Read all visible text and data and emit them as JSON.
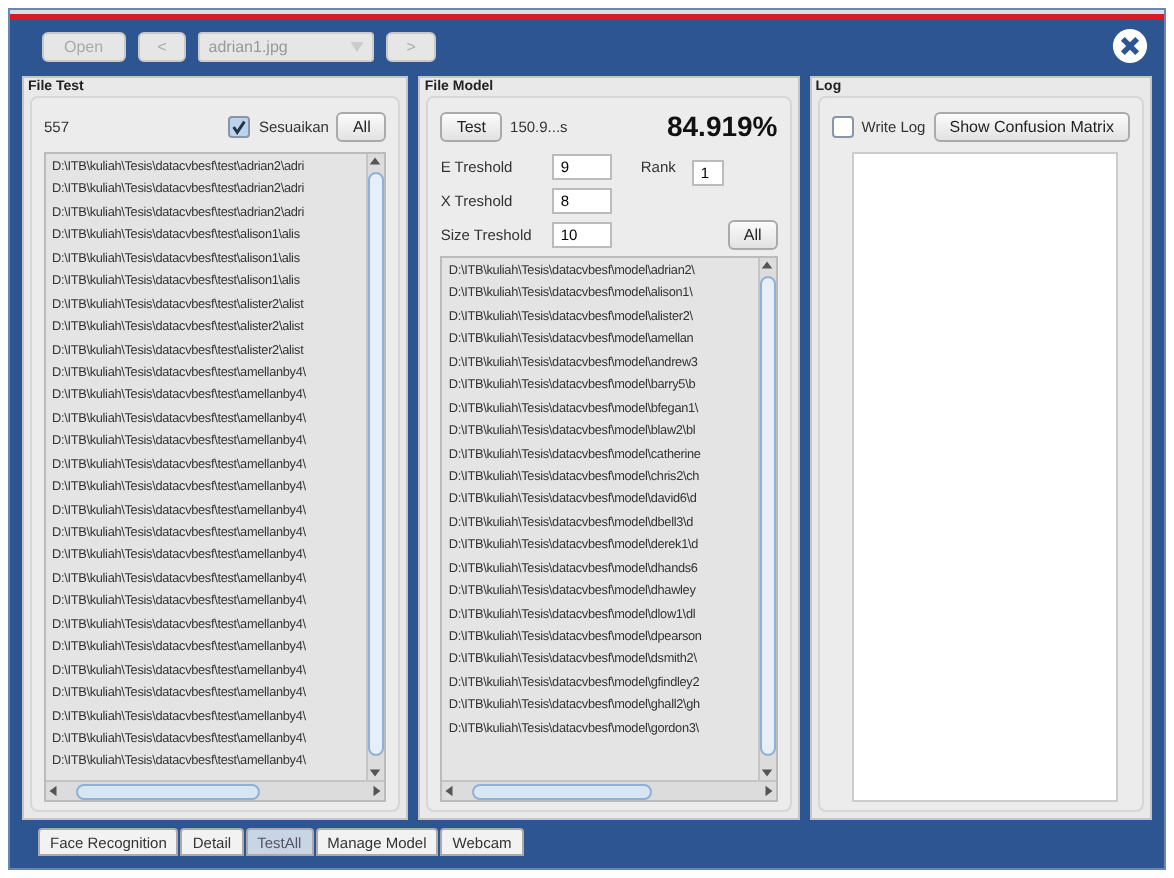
{
  "toolbar": {
    "open": {
      "label": "Open",
      "disabled": true
    },
    "prev": {
      "label": "<",
      "disabled": true
    },
    "file": {
      "value": "adrian1.jpg",
      "disabled": true
    },
    "next": {
      "label": ">",
      "disabled": true
    }
  },
  "file_test": {
    "title": "File Test",
    "count": "557",
    "adjust": {
      "label": "Sesuaikan",
      "checked": true
    },
    "all_button": "All",
    "files": [
      "D:\\ITB\\kuliah\\Tesis\\datacvbesf\\test\\adrian2\\adri",
      "D:\\ITB\\kuliah\\Tesis\\datacvbesf\\test\\adrian2\\adri",
      "D:\\ITB\\kuliah\\Tesis\\datacvbesf\\test\\adrian2\\adri",
      "D:\\ITB\\kuliah\\Tesis\\datacvbesf\\test\\alison1\\alis",
      "D:\\ITB\\kuliah\\Tesis\\datacvbesf\\test\\alison1\\alis",
      "D:\\ITB\\kuliah\\Tesis\\datacvbesf\\test\\alison1\\alis",
      "D:\\ITB\\kuliah\\Tesis\\datacvbesf\\test\\alister2\\alist",
      "D:\\ITB\\kuliah\\Tesis\\datacvbesf\\test\\alister2\\alist",
      "D:\\ITB\\kuliah\\Tesis\\datacvbesf\\test\\alister2\\alist",
      "D:\\ITB\\kuliah\\Tesis\\datacvbesf\\test\\amellanby4\\",
      "D:\\ITB\\kuliah\\Tesis\\datacvbesf\\test\\amellanby4\\",
      "D:\\ITB\\kuliah\\Tesis\\datacvbesf\\test\\amellanby4\\",
      "D:\\ITB\\kuliah\\Tesis\\datacvbesf\\test\\amellanby4\\",
      "D:\\ITB\\kuliah\\Tesis\\datacvbesf\\test\\amellanby4\\",
      "D:\\ITB\\kuliah\\Tesis\\datacvbesf\\test\\amellanby4\\",
      "D:\\ITB\\kuliah\\Tesis\\datacvbesf\\test\\amellanby4\\",
      "D:\\ITB\\kuliah\\Tesis\\datacvbesf\\test\\amellanby4\\",
      "D:\\ITB\\kuliah\\Tesis\\datacvbesf\\test\\amellanby4\\",
      "D:\\ITB\\kuliah\\Tesis\\datacvbesf\\test\\amellanby4\\",
      "D:\\ITB\\kuliah\\Tesis\\datacvbesf\\test\\amellanby4\\",
      "D:\\ITB\\kuliah\\Tesis\\datacvbesf\\test\\amellanby4\\",
      "D:\\ITB\\kuliah\\Tesis\\datacvbesf\\test\\amellanby4\\",
      "D:\\ITB\\kuliah\\Tesis\\datacvbesf\\test\\amellanby4\\",
      "D:\\ITB\\kuliah\\Tesis\\datacvbesf\\test\\amellanby4\\",
      "D:\\ITB\\kuliah\\Tesis\\datacvbesf\\test\\amellanby4\\",
      "D:\\ITB\\kuliah\\Tesis\\datacvbesf\\test\\amellanby4\\",
      "D:\\ITB\\kuliah\\Tesis\\datacvbesf\\test\\amellanby4\\"
    ]
  },
  "file_model": {
    "title": "File Model",
    "test_button": "Test",
    "time": "150.9...s",
    "accuracy": "84.919%",
    "fields": [
      {
        "label": "E Treshold",
        "value": "9"
      },
      {
        "label": "X Treshold",
        "value": "8"
      },
      {
        "label": "Size Treshold",
        "value": "10"
      }
    ],
    "rank": {
      "label": "Rank",
      "value": "1"
    },
    "all_button": "All",
    "files": [
      "D:\\ITB\\kuliah\\Tesis\\datacvbesf\\model\\adrian2\\",
      "D:\\ITB\\kuliah\\Tesis\\datacvbesf\\model\\alison1\\",
      "D:\\ITB\\kuliah\\Tesis\\datacvbesf\\model\\alister2\\",
      "D:\\ITB\\kuliah\\Tesis\\datacvbesf\\model\\amellan",
      "D:\\ITB\\kuliah\\Tesis\\datacvbesf\\model\\andrew3",
      "D:\\ITB\\kuliah\\Tesis\\datacvbesf\\model\\barry5\\b",
      "D:\\ITB\\kuliah\\Tesis\\datacvbesf\\model\\bfegan1\\",
      "D:\\ITB\\kuliah\\Tesis\\datacvbesf\\model\\blaw2\\bl",
      "D:\\ITB\\kuliah\\Tesis\\datacvbesf\\model\\catherine",
      "D:\\ITB\\kuliah\\Tesis\\datacvbesf\\model\\chris2\\ch",
      "D:\\ITB\\kuliah\\Tesis\\datacvbesf\\model\\david6\\d",
      "D:\\ITB\\kuliah\\Tesis\\datacvbesf\\model\\dbell3\\d",
      "D:\\ITB\\kuliah\\Tesis\\datacvbesf\\model\\derek1\\d",
      "D:\\ITB\\kuliah\\Tesis\\datacvbesf\\model\\dhands6",
      "D:\\ITB\\kuliah\\Tesis\\datacvbesf\\model\\dhawley",
      "D:\\ITB\\kuliah\\Tesis\\datacvbesf\\model\\dlow1\\dl",
      "D:\\ITB\\kuliah\\Tesis\\datacvbesf\\model\\dpearson",
      "D:\\ITB\\kuliah\\Tesis\\datacvbesf\\model\\dsmith2\\",
      "D:\\ITB\\kuliah\\Tesis\\datacvbesf\\model\\gfindley2",
      "D:\\ITB\\kuliah\\Tesis\\datacvbesf\\model\\ghall2\\gh",
      "D:\\ITB\\kuliah\\Tesis\\datacvbesf\\model\\gordon3\\"
    ]
  },
  "log": {
    "title": "Log",
    "write_log": {
      "label": "Write Log",
      "checked": false
    },
    "matrix_button": "Show Confusion Matrix"
  },
  "tabs": [
    {
      "label": "Face Recognition",
      "selected": false
    },
    {
      "label": "Detail",
      "selected": false
    },
    {
      "label": "TestAll",
      "selected": true
    },
    {
      "label": "Manage Model",
      "selected": false
    },
    {
      "label": "Webcam",
      "selected": false
    }
  ]
}
